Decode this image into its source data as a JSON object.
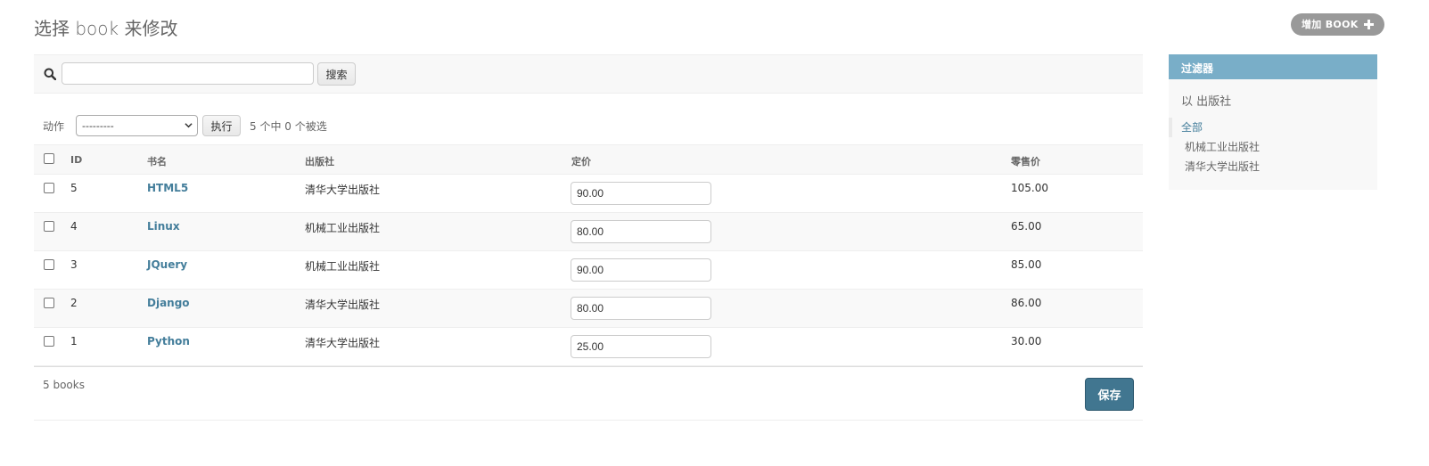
{
  "header": {
    "title": "选择 book 来修改",
    "add_button_label": "增加 BOOK"
  },
  "search": {
    "placeholder": "",
    "value": "",
    "button_label": "搜索"
  },
  "actions": {
    "label": "动作",
    "selected_option": "---------",
    "go_button_label": "执行",
    "counter": "5 个中 0 个被选"
  },
  "table": {
    "headers": [
      "ID",
      "书名",
      "出版社",
      "定价",
      "零售价"
    ],
    "rows": [
      {
        "id": "5",
        "name": "HTML5",
        "publisher": "清华大学出版社",
        "price": "90.00",
        "retail": "105.00"
      },
      {
        "id": "4",
        "name": "Linux",
        "publisher": "机械工业出版社",
        "price": "80.00",
        "retail": "65.00"
      },
      {
        "id": "3",
        "name": "JQuery",
        "publisher": "机械工业出版社",
        "price": "90.00",
        "retail": "85.00"
      },
      {
        "id": "2",
        "name": "Django",
        "publisher": "清华大学出版社",
        "price": "80.00",
        "retail": "86.00"
      },
      {
        "id": "1",
        "name": "Python",
        "publisher": "清华大学出版社",
        "price": "25.00",
        "retail": "30.00"
      }
    ]
  },
  "footer": {
    "paginator": "5 books",
    "save_label": "保存"
  },
  "filter": {
    "title": "过滤器",
    "by_label": "以 出版社",
    "items": [
      "全部",
      "机械工业出版社",
      "清华大学出版社"
    ],
    "selected_index": 0
  },
  "colors": {
    "link": "#447e9b",
    "filter_header": "#79aec8",
    "save_button": "#417690",
    "add_button": "#999999"
  }
}
